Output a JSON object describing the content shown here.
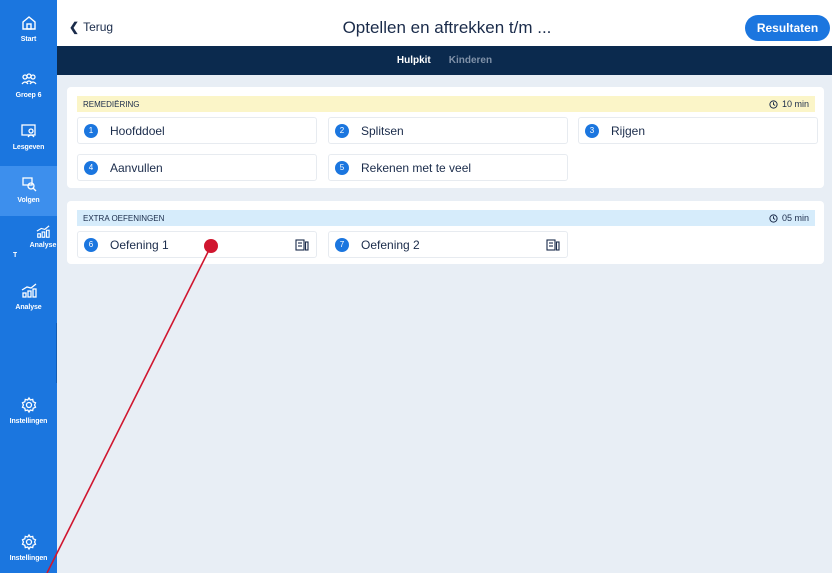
{
  "sidebar": {
    "items": [
      {
        "label": "Start",
        "icon": "home-icon"
      },
      {
        "label": "Groep 6",
        "icon": "group-icon"
      },
      {
        "label": "Lesgeven",
        "icon": "teach-icon"
      },
      {
        "label": "Volgen",
        "icon": "track-icon"
      },
      {
        "label": "Analyse",
        "icon": "analysis-icon"
      },
      {
        "label": "Instellingen",
        "icon": "settings-icon"
      },
      {
        "label": "Instellingen",
        "icon": "settings-icon"
      }
    ],
    "flyout": {
      "label": "Analyse",
      "stub": "Ti"
    }
  },
  "header": {
    "back_label": "Terug",
    "title": "Optellen en aftrekken t/m ...",
    "results_label": "Resultaten"
  },
  "tabs": [
    {
      "label": "Hulpkit",
      "active": true
    },
    {
      "label": "Kinderen",
      "active": false
    }
  ],
  "sections": [
    {
      "title": "REMEDIËRING",
      "time": "10 min",
      "items": [
        {
          "num": "1",
          "label": "Hoofddoel"
        },
        {
          "num": "2",
          "label": "Splitsen"
        },
        {
          "num": "3",
          "label": "Rijgen"
        },
        {
          "num": "4",
          "label": "Aanvullen"
        },
        {
          "num": "5",
          "label": "Rekenen met te veel"
        }
      ]
    },
    {
      "title": "EXTRA OEFENINGEN",
      "time": "05 min",
      "items": [
        {
          "num": "6",
          "label": "Oefening 1"
        },
        {
          "num": "7",
          "label": "Oefening 2"
        }
      ]
    }
  ],
  "colors": {
    "sidebar": "#1b76df",
    "tabbar": "#0b2a4e",
    "accent": "#1b76df",
    "annotation": "#d0162f",
    "remediering_header": "#fbf5c8",
    "extra_header": "#d6ecfb"
  }
}
